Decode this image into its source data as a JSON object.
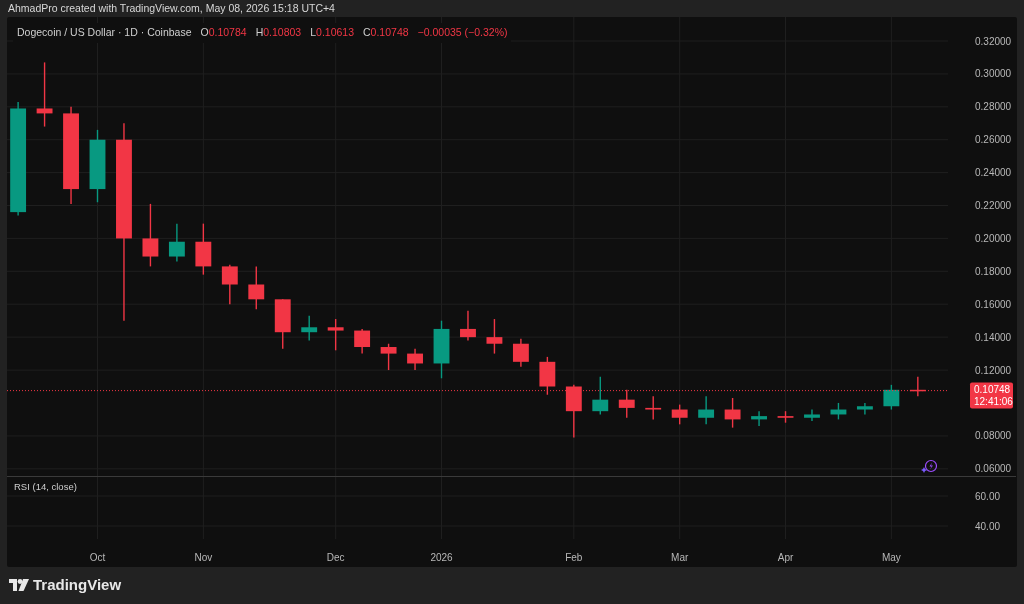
{
  "caption": "AhmadPro created with TradingView.com, May 08, 2026 15:18 UTC+4",
  "legend": {
    "symbol": "Dogecoin / US Dollar · 1D · Coinbase",
    "ohlc": [
      {
        "label": "O",
        "value": "0.10784"
      },
      {
        "label": "H",
        "value": "0.10803"
      },
      {
        "label": "L",
        "value": "0.10613"
      },
      {
        "label": "C",
        "value": "0.10748"
      }
    ],
    "change": "−0.00035 (−0.32%)"
  },
  "chart": {
    "chart_data": {
      "type": "candlestick",
      "categories": [
        null,
        null,
        null,
        "Oct",
        null,
        null,
        null,
        "Nov",
        null,
        null,
        null,
        null,
        "Dec",
        null,
        null,
        null,
        "2026",
        null,
        null,
        null,
        null,
        "Feb",
        null,
        null,
        null,
        "Mar",
        null,
        null,
        null,
        "Apr",
        null,
        null,
        null,
        "May",
        null
      ],
      "ohlc": [
        [
          0.216,
          0.283,
          0.214,
          0.279
        ],
        [
          0.279,
          0.307,
          0.268,
          0.276
        ],
        [
          0.276,
          0.28,
          0.221,
          0.23
        ],
        [
          0.23,
          0.266,
          0.222,
          0.26
        ],
        [
          0.26,
          0.27,
          0.15,
          0.2
        ],
        [
          0.2,
          0.221,
          0.183,
          0.189
        ],
        [
          0.189,
          0.209,
          0.186,
          0.198
        ],
        [
          0.198,
          0.209,
          0.178,
          0.183
        ],
        [
          0.183,
          0.184,
          0.16,
          0.172
        ],
        [
          0.172,
          0.183,
          0.157,
          0.163
        ],
        [
          0.163,
          0.163,
          0.133,
          0.143
        ],
        [
          0.143,
          0.153,
          0.138,
          0.146
        ],
        [
          0.146,
          0.151,
          0.132,
          0.144
        ],
        [
          0.144,
          0.145,
          0.13,
          0.134
        ],
        [
          0.134,
          0.136,
          0.12,
          0.13
        ],
        [
          0.13,
          0.133,
          0.12,
          0.124
        ],
        [
          0.124,
          0.15,
          0.115,
          0.145
        ],
        [
          0.145,
          0.156,
          0.138,
          0.14
        ],
        [
          0.14,
          0.151,
          0.13,
          0.136
        ],
        [
          0.136,
          0.139,
          0.122,
          0.125
        ],
        [
          0.125,
          0.128,
          0.105,
          0.11
        ],
        [
          0.11,
          0.111,
          0.079,
          0.095
        ],
        [
          0.095,
          0.116,
          0.093,
          0.102
        ],
        [
          0.102,
          0.108,
          0.091,
          0.097
        ],
        [
          0.097,
          0.104,
          0.09,
          0.096
        ],
        [
          0.096,
          0.099,
          0.087,
          0.091
        ],
        [
          0.091,
          0.104,
          0.087,
          0.096
        ],
        [
          0.096,
          0.103,
          0.085,
          0.09
        ],
        [
          0.09,
          0.095,
          0.086,
          0.092
        ],
        [
          0.092,
          0.095,
          0.088,
          0.091
        ],
        [
          0.091,
          0.096,
          0.089,
          0.093
        ],
        [
          0.093,
          0.1,
          0.09,
          0.096
        ],
        [
          0.096,
          0.1,
          0.093,
          0.098
        ],
        [
          0.098,
          0.111,
          0.096,
          0.108
        ],
        [
          0.108,
          0.116,
          0.104,
          0.1075
        ]
      ],
      "ylim": [
        0.0556,
        0.3346
      ],
      "grid": true,
      "ref_lines": [
        {
          "axis": "y",
          "value": 0.1075,
          "color": "#f23645"
        }
      ],
      "yticks": [
        {
          "value": 0.32,
          "label": "0.32000"
        },
        {
          "value": 0.3,
          "label": "0.30000"
        },
        {
          "value": 0.28,
          "label": "0.28000"
        },
        {
          "value": 0.26,
          "label": "0.26000"
        },
        {
          "value": 0.24,
          "label": "0.24000"
        },
        {
          "value": 0.22,
          "label": "0.22000"
        },
        {
          "value": 0.2,
          "label": "0.20000"
        },
        {
          "value": 0.18,
          "label": "0.18000"
        },
        {
          "value": 0.16,
          "label": "0.16000"
        },
        {
          "value": 0.14,
          "label": "0.14000"
        },
        {
          "value": 0.12,
          "label": "0.12000"
        },
        {
          "value": 0.08,
          "label": "0.08000"
        },
        {
          "value": 0.06,
          "label": "0.06000"
        }
      ]
    },
    "last_price": {
      "label": "0.10748",
      "countdown": "12:41:06"
    }
  },
  "rsi": {
    "title": "RSI (14, close)",
    "yticks": [
      "60.00",
      "40.00"
    ]
  },
  "brand": "TradingView"
}
